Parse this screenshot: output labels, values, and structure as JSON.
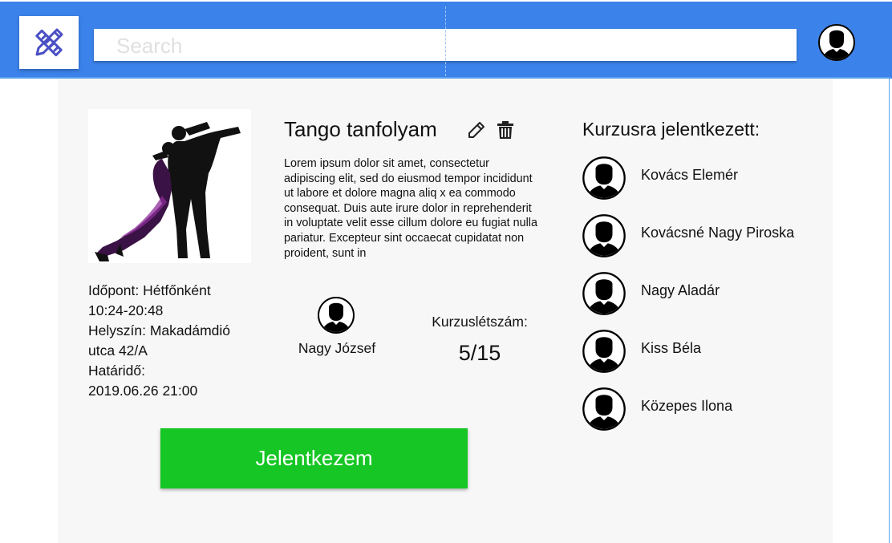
{
  "header": {
    "search_placeholder": "Search",
    "logo_icon": "pencil-ruler-icon",
    "user_icon": "user-avatar-icon",
    "bar_color": "#3b82ea"
  },
  "course": {
    "title": "Tango tanfolyam",
    "edit_icon": "pencil-icon",
    "delete_icon": "trash-icon",
    "description": "Lorem ipsum dolor sit amet, consectetur adipiscing elit, sed do eiusmod tempor incididunt ut labore et dolore magna aliq x ea commodo consequat. Duis aute irure dolor in reprehenderit in voluptate velit esse cillum dolore eu fugiat nulla pariatur. Excepteur sint occaecat cupidatat non proident, sunt in",
    "time_line1": "Időpont: Hétfőnként",
    "time_line2": "10:24-20:48",
    "place_line1": "Helyszín: Makadámdió",
    "place_line2": "utca 42/A",
    "deadline_line1": "Határidő:",
    "deadline_line2": "2019.06.26 21:00",
    "organizer": "Nagy József",
    "capacity_label": "Kurzuslétszám:",
    "capacity_value": "5/15",
    "apply_label": "Jelentkezem",
    "apply_color": "#16c624"
  },
  "attendees": {
    "title": "Kurzusra jelentkezett:",
    "list": [
      {
        "name": "Kovács Elemér"
      },
      {
        "name": "Kovácsné Nagy Piroska"
      },
      {
        "name": "Nagy Aladár"
      },
      {
        "name": "Kiss Béla"
      },
      {
        "name": "Közepes Ilona"
      }
    ]
  }
}
